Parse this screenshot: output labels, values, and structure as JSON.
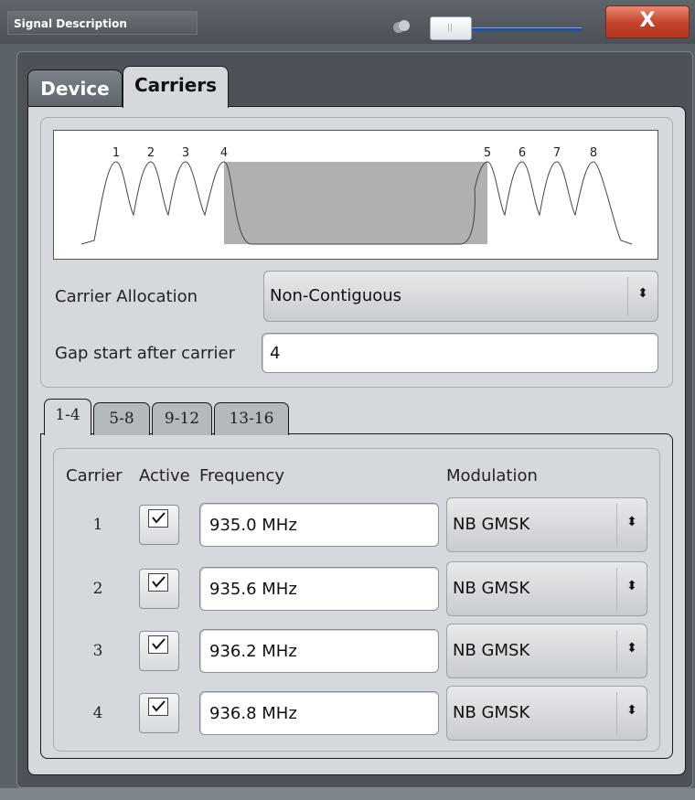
{
  "window": {
    "title": "Signal Description",
    "close_label": "X"
  },
  "main_tabs": [
    {
      "label": "Device",
      "active": false
    },
    {
      "label": "Carriers",
      "active": true
    }
  ],
  "diagram": {
    "carrier_labels": [
      "1",
      "2",
      "3",
      "4",
      "5",
      "6",
      "7",
      "8"
    ],
    "gap_after_carrier": 4
  },
  "carrier_allocation": {
    "label": "Carrier Allocation",
    "value": "Non-Contiguous",
    "arrow": "⬍"
  },
  "gap_start": {
    "label": "Gap start after carrier",
    "value": "4"
  },
  "sub_tabs": [
    {
      "label": "1-4",
      "active": true
    },
    {
      "label": "5-8",
      "active": false
    },
    {
      "label": "9-12",
      "active": false
    },
    {
      "label": "13-16",
      "active": false
    }
  ],
  "table": {
    "headers": {
      "carrier": "Carrier",
      "active": "Active",
      "frequency": "Frequency",
      "modulation": "Modulation"
    },
    "rows": [
      {
        "carrier": "1",
        "active": true,
        "frequency": "935.0 MHz",
        "modulation": "NB GMSK"
      },
      {
        "carrier": "2",
        "active": true,
        "frequency": "935.6 MHz",
        "modulation": "NB GMSK"
      },
      {
        "carrier": "3",
        "active": true,
        "frequency": "936.2 MHz",
        "modulation": "NB GMSK"
      },
      {
        "carrier": "4",
        "active": true,
        "frequency": "936.8 MHz",
        "modulation": "NB GMSK"
      }
    ]
  },
  "colors": {
    "close_button": "#c4412a",
    "slider_track": "#1f4fae",
    "panel_bg": "#d5d8dc",
    "gap_fill": "#b0b0b0"
  }
}
